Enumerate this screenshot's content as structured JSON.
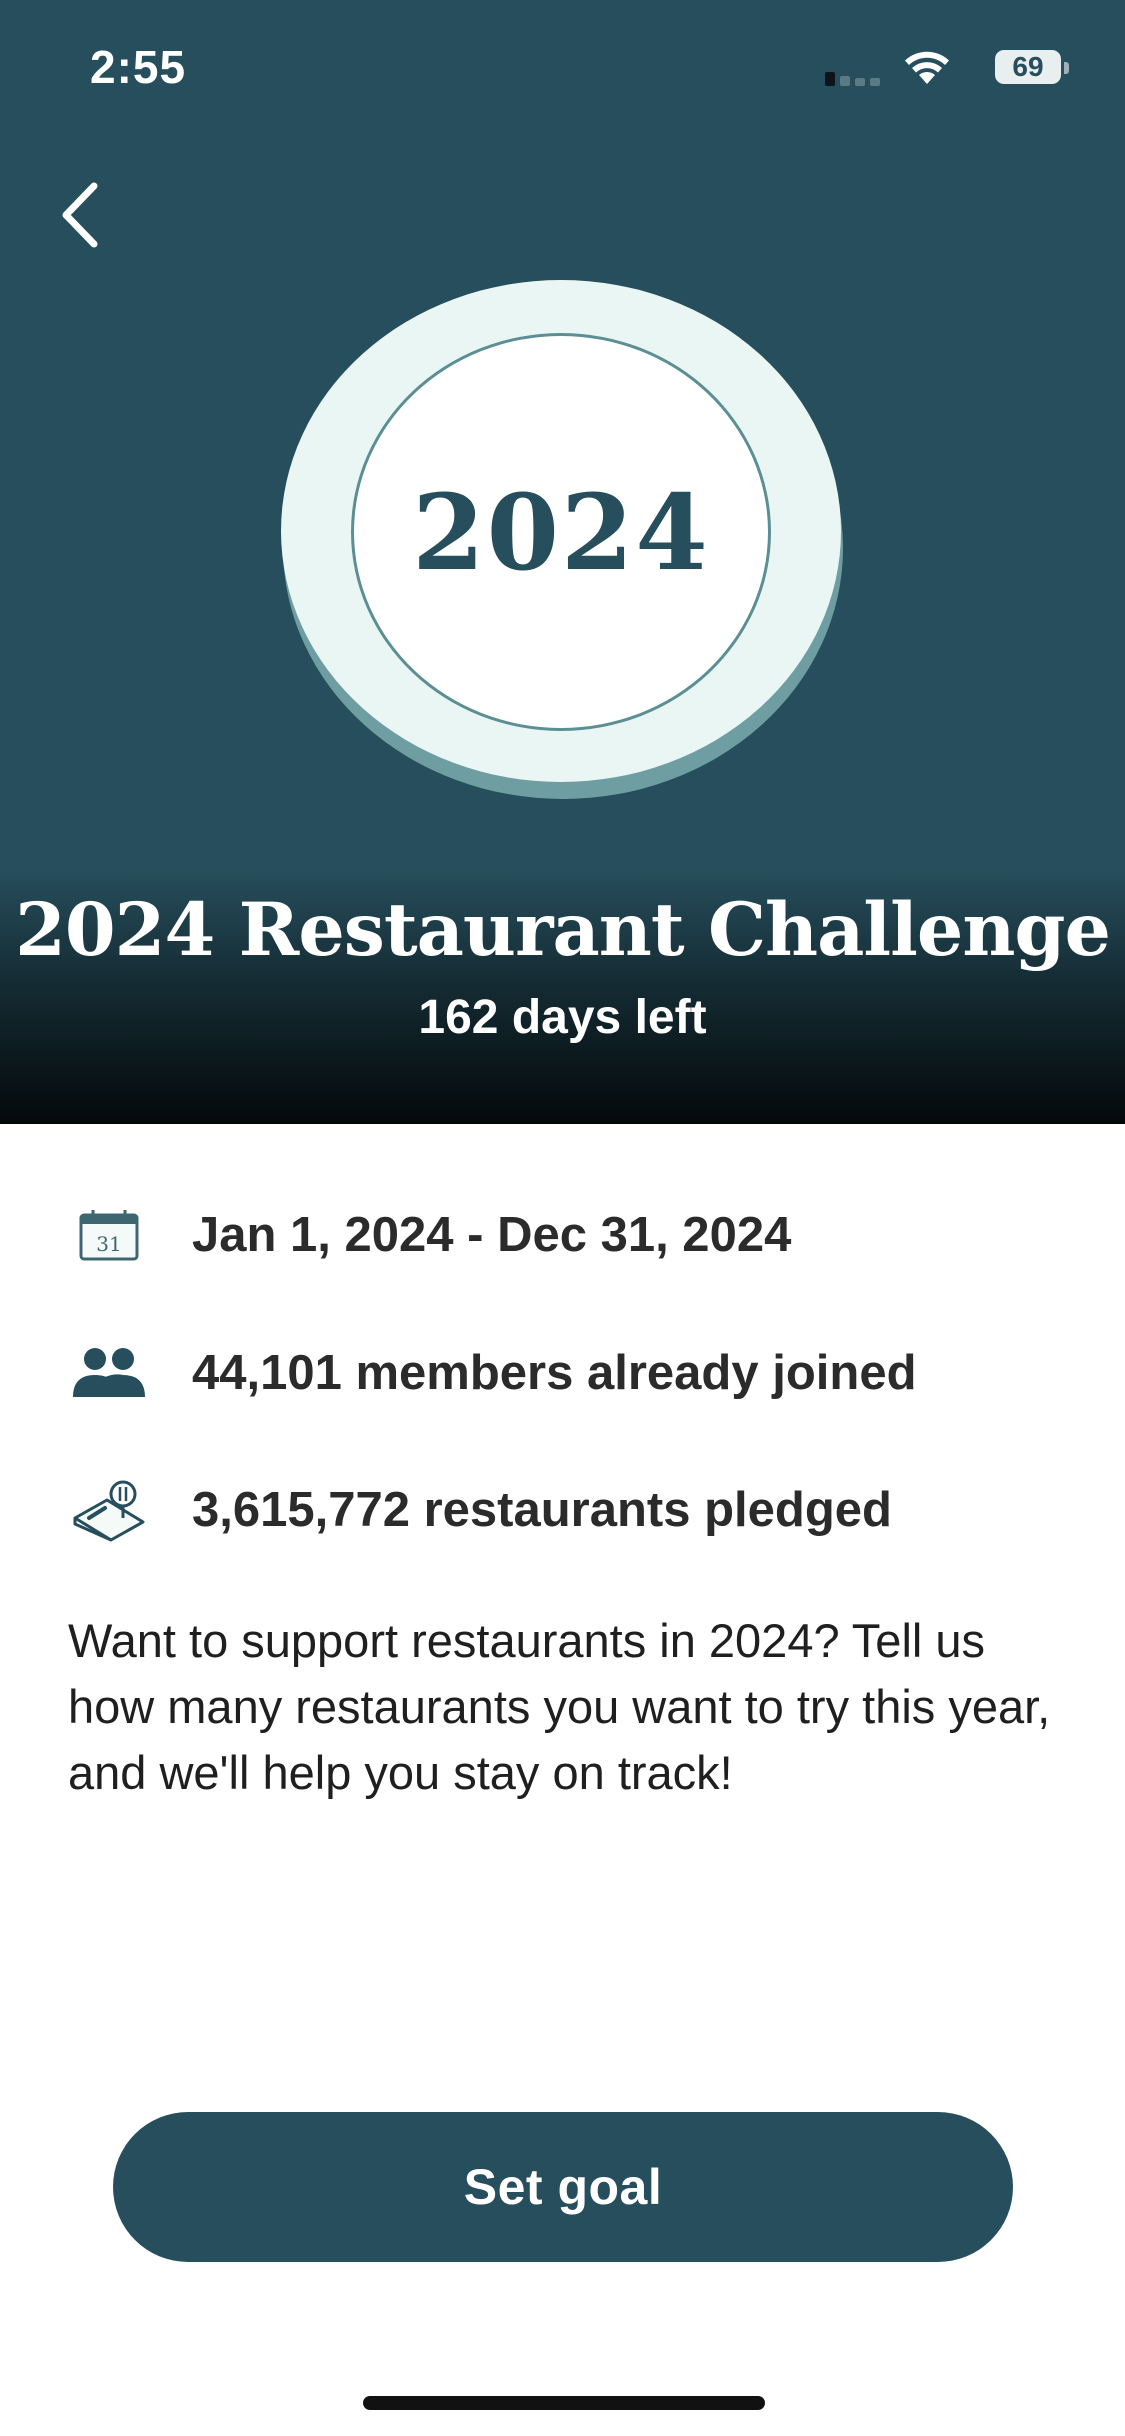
{
  "status_bar": {
    "time": "2:55",
    "battery": "69"
  },
  "hero": {
    "badge_year": "2024",
    "title": "2024 Restaurant Challenge",
    "subtitle": "162 days left"
  },
  "info": {
    "date_range": "Jan 1, 2024 - Dec 31, 2024",
    "members": "44,101 members already joined",
    "restaurants": "3,615,772 restaurants pledged",
    "calendar_day": "31"
  },
  "description": "Want to support restaurants in 2024? Tell us how many restaurants you want to try this year, and we'll help you stay on track!",
  "cta": {
    "label": "Set goal"
  },
  "colors": {
    "primary": "#264e5c",
    "badge_ring": "#eaf6f3",
    "badge_border": "#5b8f93"
  }
}
